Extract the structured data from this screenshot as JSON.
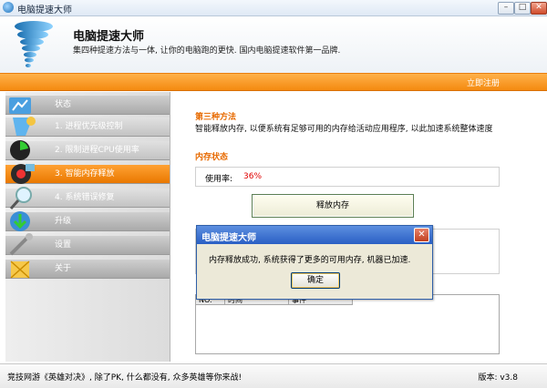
{
  "window": {
    "title": "电脑提速大师",
    "min": "–",
    "max": "□",
    "close": "✕"
  },
  "header": {
    "title": "电脑提速大师",
    "subtitle": "集四种提速方法与一体, 让你的电脑跑的更快. 国内电脑提速软件第一品牌."
  },
  "topbar": {
    "register_label": "立即注册"
  },
  "sidebar": {
    "items": [
      {
        "label": "状态",
        "icon": "status-icon"
      },
      {
        "label": "1. 进程优先级控制",
        "icon": "priority-icon"
      },
      {
        "label": "2. 限制进程CPU使用率",
        "icon": "cpu-icon"
      },
      {
        "label": "3. 智能内存释放",
        "icon": "memory-icon"
      },
      {
        "label": "4. 系统错误修复",
        "icon": "magnifier-icon"
      },
      {
        "label": "升级",
        "icon": "upgrade-icon"
      },
      {
        "label": "设置",
        "icon": "settings-icon"
      },
      {
        "label": "关于",
        "icon": "about-icon"
      }
    ]
  },
  "main": {
    "method_title": "第三种方法",
    "method_desc": "智能释放内存, 以便系统有足够可用的内存给活动应用程序, 以此加速系统整体速度",
    "memory_section_title": "内存状态",
    "usage_label": "使用率:",
    "usage_value": "36%",
    "release_button": "释放内存",
    "log_columns": [
      "NO.",
      "时间",
      "事件"
    ]
  },
  "dialog": {
    "title": "电脑提速大师",
    "message": "内存释放成功, 系统获得了更多的可用内存, 机器已加速.",
    "ok_button": "确定",
    "close": "✕"
  },
  "status": {
    "ad_text": "竞技网游《英雄对决》, 除了PK, 什么都没有, 众多英雄等你来战!",
    "version": "版本: v3.8"
  },
  "colors": {
    "accent_orange": "#f48a10",
    "dialog_blue": "#2a5fc4",
    "usage_red": "#e00000"
  }
}
